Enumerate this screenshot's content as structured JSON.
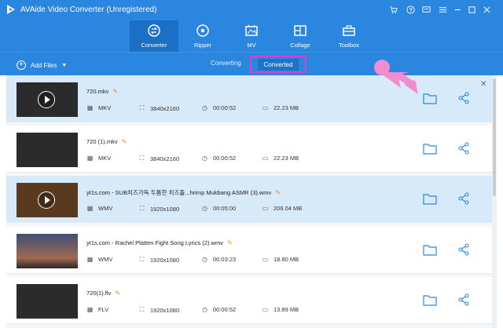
{
  "app": {
    "title": "AVAide Video Converter (Unregistered)"
  },
  "nav": {
    "items": [
      {
        "label": "Converter",
        "icon": "converter-icon",
        "active": true
      },
      {
        "label": "Ripper",
        "icon": "ripper-icon",
        "active": false
      },
      {
        "label": "MV",
        "icon": "mv-icon",
        "active": false
      },
      {
        "label": "Collage",
        "icon": "collage-icon",
        "active": false
      },
      {
        "label": "Toolbox",
        "icon": "toolbox-icon",
        "active": false
      }
    ]
  },
  "toolbar": {
    "add_files_label": "Add Files",
    "tabs": {
      "converting": "Converting",
      "converted": "Converted"
    }
  },
  "files": [
    {
      "name": "720.mkv",
      "format": "MKV",
      "resolution": "3840x2160",
      "duration": "00:00:52",
      "size": "22.23 MB",
      "highlight": true,
      "play": true
    },
    {
      "name": "720 (1).mkv",
      "format": "MKV",
      "resolution": "3840x2160",
      "duration": "00:00:52",
      "size": "22.23 MB",
      "highlight": false,
      "play": false
    },
    {
      "name": "yt1s.com - SUB치즈가득 두툼한 치즈돌...hrimp Mukbang ASMR (3).wmv",
      "format": "WMV",
      "resolution": "1920x1080",
      "duration": "00:05:00",
      "size": "206.04 MB",
      "highlight": true,
      "play": true
    },
    {
      "name": "yt1s.com - Rachel Platten  Fight Song Lyrics (2).wmv",
      "format": "WMV",
      "resolution": "1920x1080",
      "duration": "00:03:23",
      "size": "18.80 MB",
      "highlight": false,
      "play": false
    },
    {
      "name": "720(1).flv",
      "format": "FLV",
      "resolution": "1920x1080",
      "duration": "00:00:52",
      "size": "13.89 MB",
      "highlight": false,
      "play": false
    }
  ],
  "colors": {
    "header_blue": "#2a86df",
    "active_tab_blue": "#1b6fc4",
    "highlight_row": "#d7eaf9",
    "annotation_magenta": "#d83fd3",
    "pointer_pink": "#f28bd0",
    "edit_orange": "#f08a1c",
    "action_blue": "#2a86df"
  }
}
